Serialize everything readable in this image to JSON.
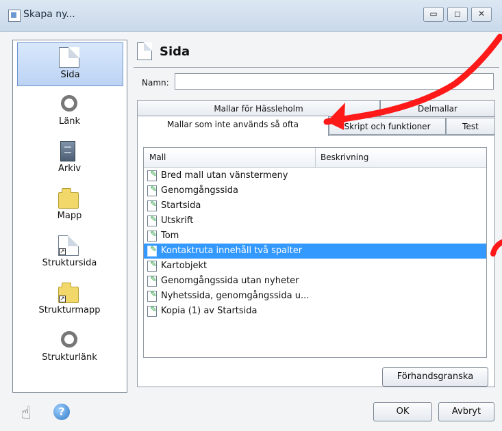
{
  "window": {
    "title": "Skapa ny...",
    "controls": [
      "▭",
      "◻",
      "✕"
    ]
  },
  "sidebar": {
    "items": [
      {
        "label": "Sida",
        "icon": "page-icon"
      },
      {
        "label": "Länk",
        "icon": "link-icon"
      },
      {
        "label": "Arkiv",
        "icon": "archive-icon"
      },
      {
        "label": "Mapp",
        "icon": "folder-icon"
      },
      {
        "label": "Struktursida",
        "icon": "structure-page-icon"
      },
      {
        "label": "Strukturmapp",
        "icon": "structure-folder-icon"
      },
      {
        "label": "Strukturlänk",
        "icon": "structure-link-icon"
      }
    ]
  },
  "header": {
    "title": "Sida"
  },
  "form": {
    "name_label": "Namn:",
    "name_value": ""
  },
  "tabs": {
    "row1": [
      "Mallar för Hässleholm",
      "Delmallar"
    ],
    "row2": [
      "Mallar som inte används så ofta",
      "Skript och funktioner",
      "Test"
    ]
  },
  "list": {
    "columns": [
      "Mall",
      "Beskrivning"
    ],
    "rows": [
      "Bred mall utan vänstermeny",
      "Genomgångssida",
      "Startsida",
      "Utskrift",
      "Tom",
      "Kontaktruta innehåll två spalter",
      "Kartobjekt",
      "Genomgångssida utan nyheter",
      "Nyhetssida, genomgångssida u...",
      "Kopia (1) av Startsida"
    ]
  },
  "buttons": {
    "preview": "Förhandsgranska",
    "ok": "OK",
    "cancel": "Avbryt"
  },
  "icons": {
    "help": "?",
    "hand": "☝"
  },
  "colors": {
    "selection": "#3399ff",
    "annotation": "#ff1a1a"
  }
}
